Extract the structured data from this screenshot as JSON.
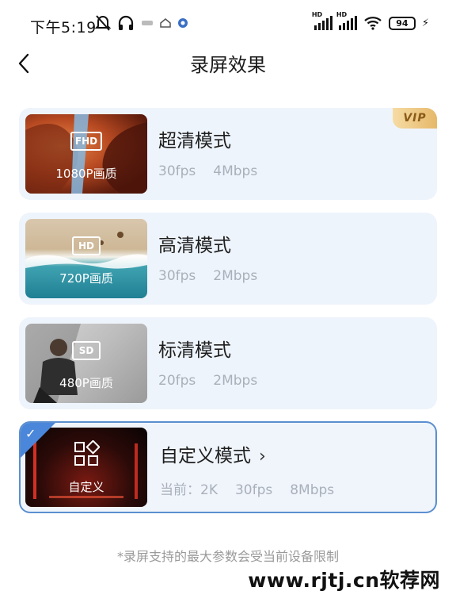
{
  "status_bar": {
    "time": "下午5:19",
    "signal_label": "HD",
    "battery": "94"
  },
  "header": {
    "title": "录屏效果"
  },
  "modes": [
    {
      "title": "超清模式",
      "badge": "FHD",
      "caption": "1080P画质",
      "fps": "30fps",
      "bitrate": "4Mbps",
      "vip": "VIP"
    },
    {
      "title": "高清模式",
      "badge": "HD",
      "caption": "720P画质",
      "fps": "30fps",
      "bitrate": "2Mbps"
    },
    {
      "title": "标清模式",
      "badge": "SD",
      "caption": "480P画质",
      "fps": "20fps",
      "bitrate": "2Mbps"
    },
    {
      "title": "自定义模式",
      "caption": "自定义",
      "current_label": "当前：",
      "resolution": "2K",
      "fps": "30fps",
      "bitrate": "8Mbps"
    }
  ],
  "footer": {
    "note": "*录屏支持的最大参数会受当前设备限制"
  },
  "watermark": "www.rjtj.cn软荐网"
}
